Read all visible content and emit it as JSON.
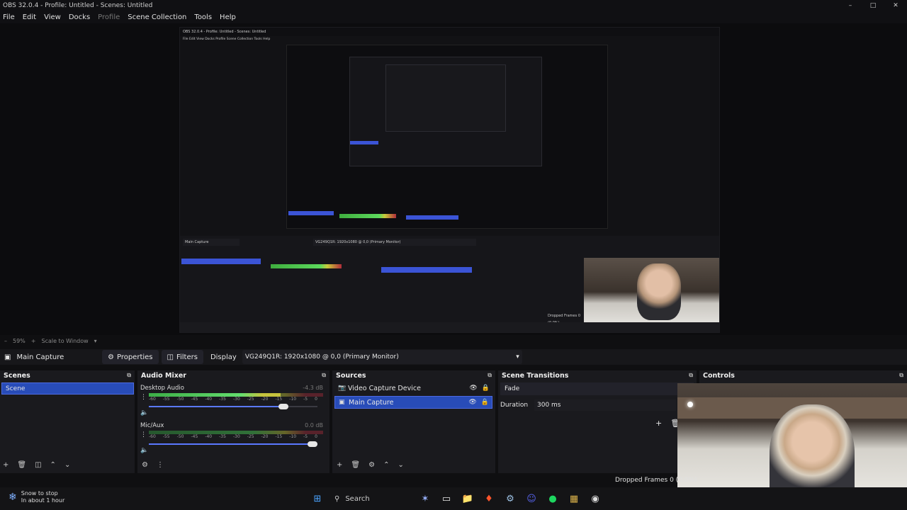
{
  "window": {
    "title": "OBS 32.0.4 - Profile: Untitled - Scenes: Untitled"
  },
  "menu": [
    "File",
    "Edit",
    "View",
    "Docks",
    "Profile",
    "Scene Collection",
    "Tools",
    "Help"
  ],
  "preview": {
    "nested_title": "OBS 32.0.4 - Profile: Untitled - Scenes: Untitled",
    "nested_menu": "File  Edit  View  Docks  Profile  Scene Collection  Tools  Help",
    "nested_source": "Main Capture",
    "nested_display": "VG249Q1R: 1920x1080 @ 0,0 (Primary Monitor)",
    "nested_dropped": "Dropped Frames 0 (0.0%)"
  },
  "zoom": {
    "level": "59%",
    "mode": "Scale to Window"
  },
  "context": {
    "source_name": "Main Capture",
    "properties_label": "Properties",
    "filters_label": "Filters",
    "display_label": "Display",
    "display_value": "VG249Q1R: 1920x1080 @ 0,0 (Primary Monitor)"
  },
  "scenes": {
    "title": "Scenes",
    "items": [
      "Scene"
    ]
  },
  "mixer": {
    "title": "Audio Mixer",
    "ticks": [
      "-60",
      "-55",
      "-50",
      "-45",
      "-40",
      "-35",
      "-30",
      "-25",
      "-20",
      "-15",
      "-10",
      "-5",
      "0"
    ],
    "tracks": [
      {
        "name": "Desktop Audio",
        "db": "-4.3 dB",
        "level": 0.78,
        "volume": 0.8
      },
      {
        "name": "Mic/Aux",
        "db": "0.0 dB",
        "level": 0.0,
        "volume": 1.0
      }
    ]
  },
  "sources": {
    "title": "Sources",
    "items": [
      {
        "name": "Video Capture Device",
        "selected": false
      },
      {
        "name": "Main Capture",
        "selected": true
      }
    ]
  },
  "transitions": {
    "title": "Scene Transitions",
    "type": "Fade",
    "duration_label": "Duration",
    "duration_value": "300 ms"
  },
  "controls": {
    "title": "Controls"
  },
  "status": {
    "dropped": "Dropped Frames 0 (0.0%)"
  },
  "taskbar": {
    "notice_line1": "Snow to stop",
    "notice_line2": "In about 1 hour",
    "search_label": "Search"
  },
  "colors": {
    "accent": "#284cb8",
    "dock_bg": "#1a1a1e",
    "bg": "#0f0f11"
  }
}
